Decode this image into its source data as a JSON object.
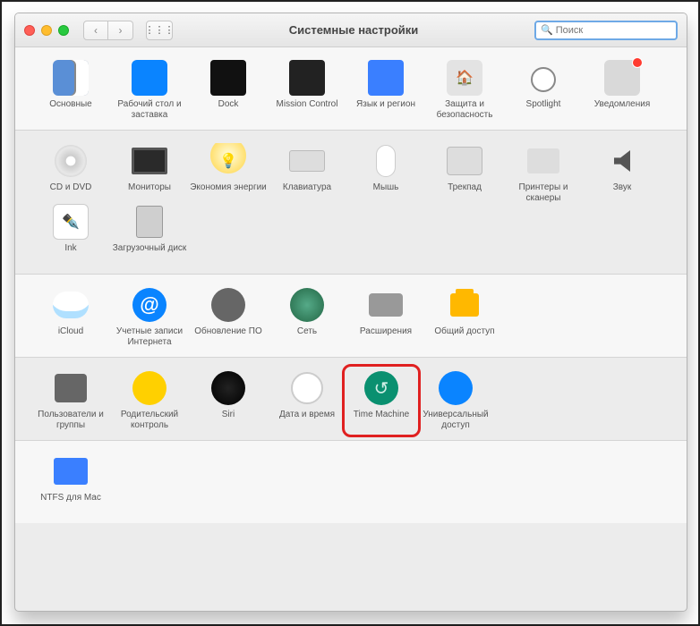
{
  "window": {
    "title": "Системные настройки"
  },
  "search": {
    "placeholder": "Поиск"
  },
  "sections": [
    {
      "items": [
        {
          "name": "general",
          "label": "Основные"
        },
        {
          "name": "desktop",
          "label": "Рабочий стол и заставка"
        },
        {
          "name": "dock",
          "label": "Dock"
        },
        {
          "name": "mission",
          "label": "Mission Control"
        },
        {
          "name": "language",
          "label": "Язык и регион"
        },
        {
          "name": "security",
          "label": "Защита и безопасность"
        },
        {
          "name": "spotlight",
          "label": "Spotlight"
        },
        {
          "name": "notifications",
          "label": "Уведомления",
          "badge": true
        }
      ]
    },
    {
      "items": [
        {
          "name": "cd-dvd",
          "label": "CD и DVD"
        },
        {
          "name": "displays",
          "label": "Мониторы"
        },
        {
          "name": "energy",
          "label": "Экономия энергии"
        },
        {
          "name": "keyboard",
          "label": "Клавиатура"
        },
        {
          "name": "mouse",
          "label": "Мышь"
        },
        {
          "name": "trackpad",
          "label": "Трекпад"
        },
        {
          "name": "printers",
          "label": "Принтеры и сканеры"
        },
        {
          "name": "sound",
          "label": "Звук"
        },
        {
          "name": "ink",
          "label": "Ink"
        },
        {
          "name": "startup",
          "label": "Загрузочный диск"
        }
      ]
    },
    {
      "items": [
        {
          "name": "icloud",
          "label": "iCloud"
        },
        {
          "name": "internet-accounts",
          "label": "Учетные записи Интернета"
        },
        {
          "name": "software-update",
          "label": "Обновление ПО"
        },
        {
          "name": "network",
          "label": "Сеть"
        },
        {
          "name": "extensions",
          "label": "Расширения"
        },
        {
          "name": "sharing",
          "label": "Общий доступ"
        }
      ]
    },
    {
      "items": [
        {
          "name": "users",
          "label": "Пользователи и группы"
        },
        {
          "name": "parental",
          "label": "Родительский контроль"
        },
        {
          "name": "siri",
          "label": "Siri"
        },
        {
          "name": "datetime",
          "label": "Дата и время"
        },
        {
          "name": "time-machine",
          "label": "Time Machine",
          "highlight": true
        },
        {
          "name": "accessibility",
          "label": "Универсальный доступ"
        }
      ]
    },
    {
      "items": [
        {
          "name": "ntfs",
          "label": "NTFS для Mac"
        }
      ]
    }
  ]
}
